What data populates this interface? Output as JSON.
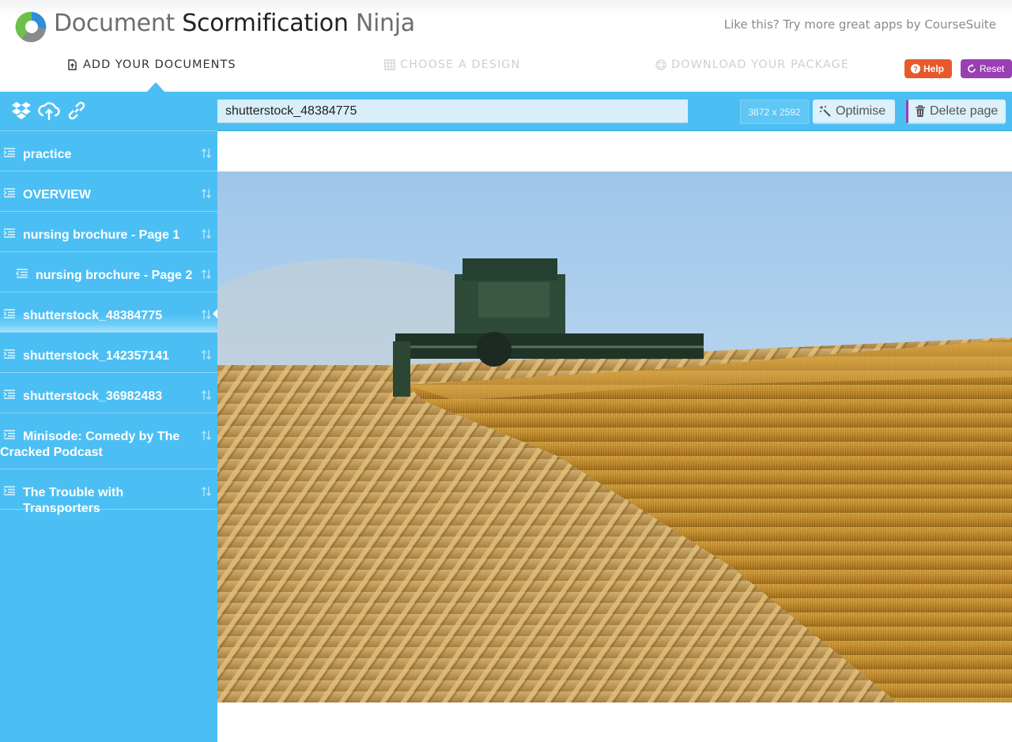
{
  "app": {
    "title_part1": "Document",
    "title_part2": "Scormification",
    "title_part3": "Ninja",
    "promo": "Like this? Try more great apps by CourseSuite"
  },
  "steps": [
    {
      "label": "ADD YOUR DOCUMENTS",
      "state": "active"
    },
    {
      "label": "CHOOSE A DESIGN",
      "state": "inactive"
    },
    {
      "label": "DOWNLOAD YOUR PACKAGE",
      "state": "inactive"
    }
  ],
  "buttons": {
    "help": "Help",
    "reset": "Reset",
    "optimise": "Optimise",
    "delete_page": "Delete page"
  },
  "colors": {
    "accent": "#4bbff4",
    "help": "#e7592b",
    "reset": "#9a3fb3"
  },
  "sidebar": {
    "tools": [
      "dropbox-icon",
      "upload-cloud-icon",
      "link-icon"
    ],
    "items": [
      {
        "label": "practice",
        "indent": false,
        "selected": false
      },
      {
        "label": "OVERVIEW",
        "indent": false,
        "selected": false
      },
      {
        "label": "nursing brochure - Page 1",
        "indent": false,
        "selected": false
      },
      {
        "label": "nursing brochure - Page 2",
        "indent": true,
        "selected": false
      },
      {
        "label": "shutterstock_48384775",
        "indent": false,
        "selected": true
      },
      {
        "label": "shutterstock_142357141",
        "indent": false,
        "selected": false
      },
      {
        "label": "shutterstock_36982483",
        "indent": false,
        "selected": false
      },
      {
        "label": "Minisode: Comedy by The Cracked Podcast",
        "indent": false,
        "selected": false
      },
      {
        "label": "The Trouble with Transporters",
        "indent": false,
        "selected": false
      }
    ]
  },
  "page": {
    "title": "shutterstock_48384775",
    "dimensions": "3872 x 2592"
  }
}
